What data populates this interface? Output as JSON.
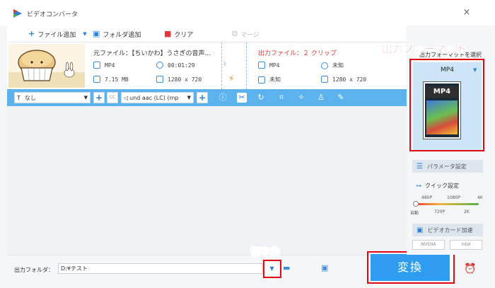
{
  "window": {
    "title": "ビデオコンバータ",
    "close_glyph": "×"
  },
  "toolbar": {
    "add_file": "ファイル追加",
    "add_folder": "フォルダ追加",
    "clear": "クリア",
    "merge": "マージ"
  },
  "file": {
    "source_label": "元ファイル：【ちいかわ】うさぎの音声...",
    "dest_label": "出力ファイル：２ クリップ",
    "source": {
      "format": "MP4",
      "duration": "00:01:29",
      "size": "7.15 MB",
      "resolution": "1280 x 720"
    },
    "dest": {
      "format": "MP4",
      "duration": "未知",
      "size": "未知",
      "resolution": "1280 x 720"
    }
  },
  "editbar": {
    "subtitle_value": "なし",
    "audio_value": "und aac (LC) (mp",
    "cc_label": "CC"
  },
  "output": {
    "label": "出力フォルダ：",
    "path": "D:¥テスト"
  },
  "convert_label": "変換",
  "right_panel": {
    "format_heading": "出力フォーマットを選択",
    "format_value": "MP4",
    "format_badge": "MP4",
    "param_label": "パラメータ設定",
    "quick_label": "クイック設定",
    "quality_top": [
      "480P",
      "1080P",
      "4K"
    ],
    "quality_bottom": [
      "自動",
      "720P",
      "2K"
    ],
    "quality_level": 0,
    "gpu_label": "ビデオカード加速",
    "vendors": [
      "NVIDIA",
      "intel"
    ]
  },
  "annotations": {
    "format_callout": "出力フォーマット",
    "save_callout": "保存先",
    "color": "#e30613"
  },
  "colors": {
    "accent": "#2e9df0",
    "editbar": "#5bb2ec",
    "dest_label": "#e53935"
  }
}
